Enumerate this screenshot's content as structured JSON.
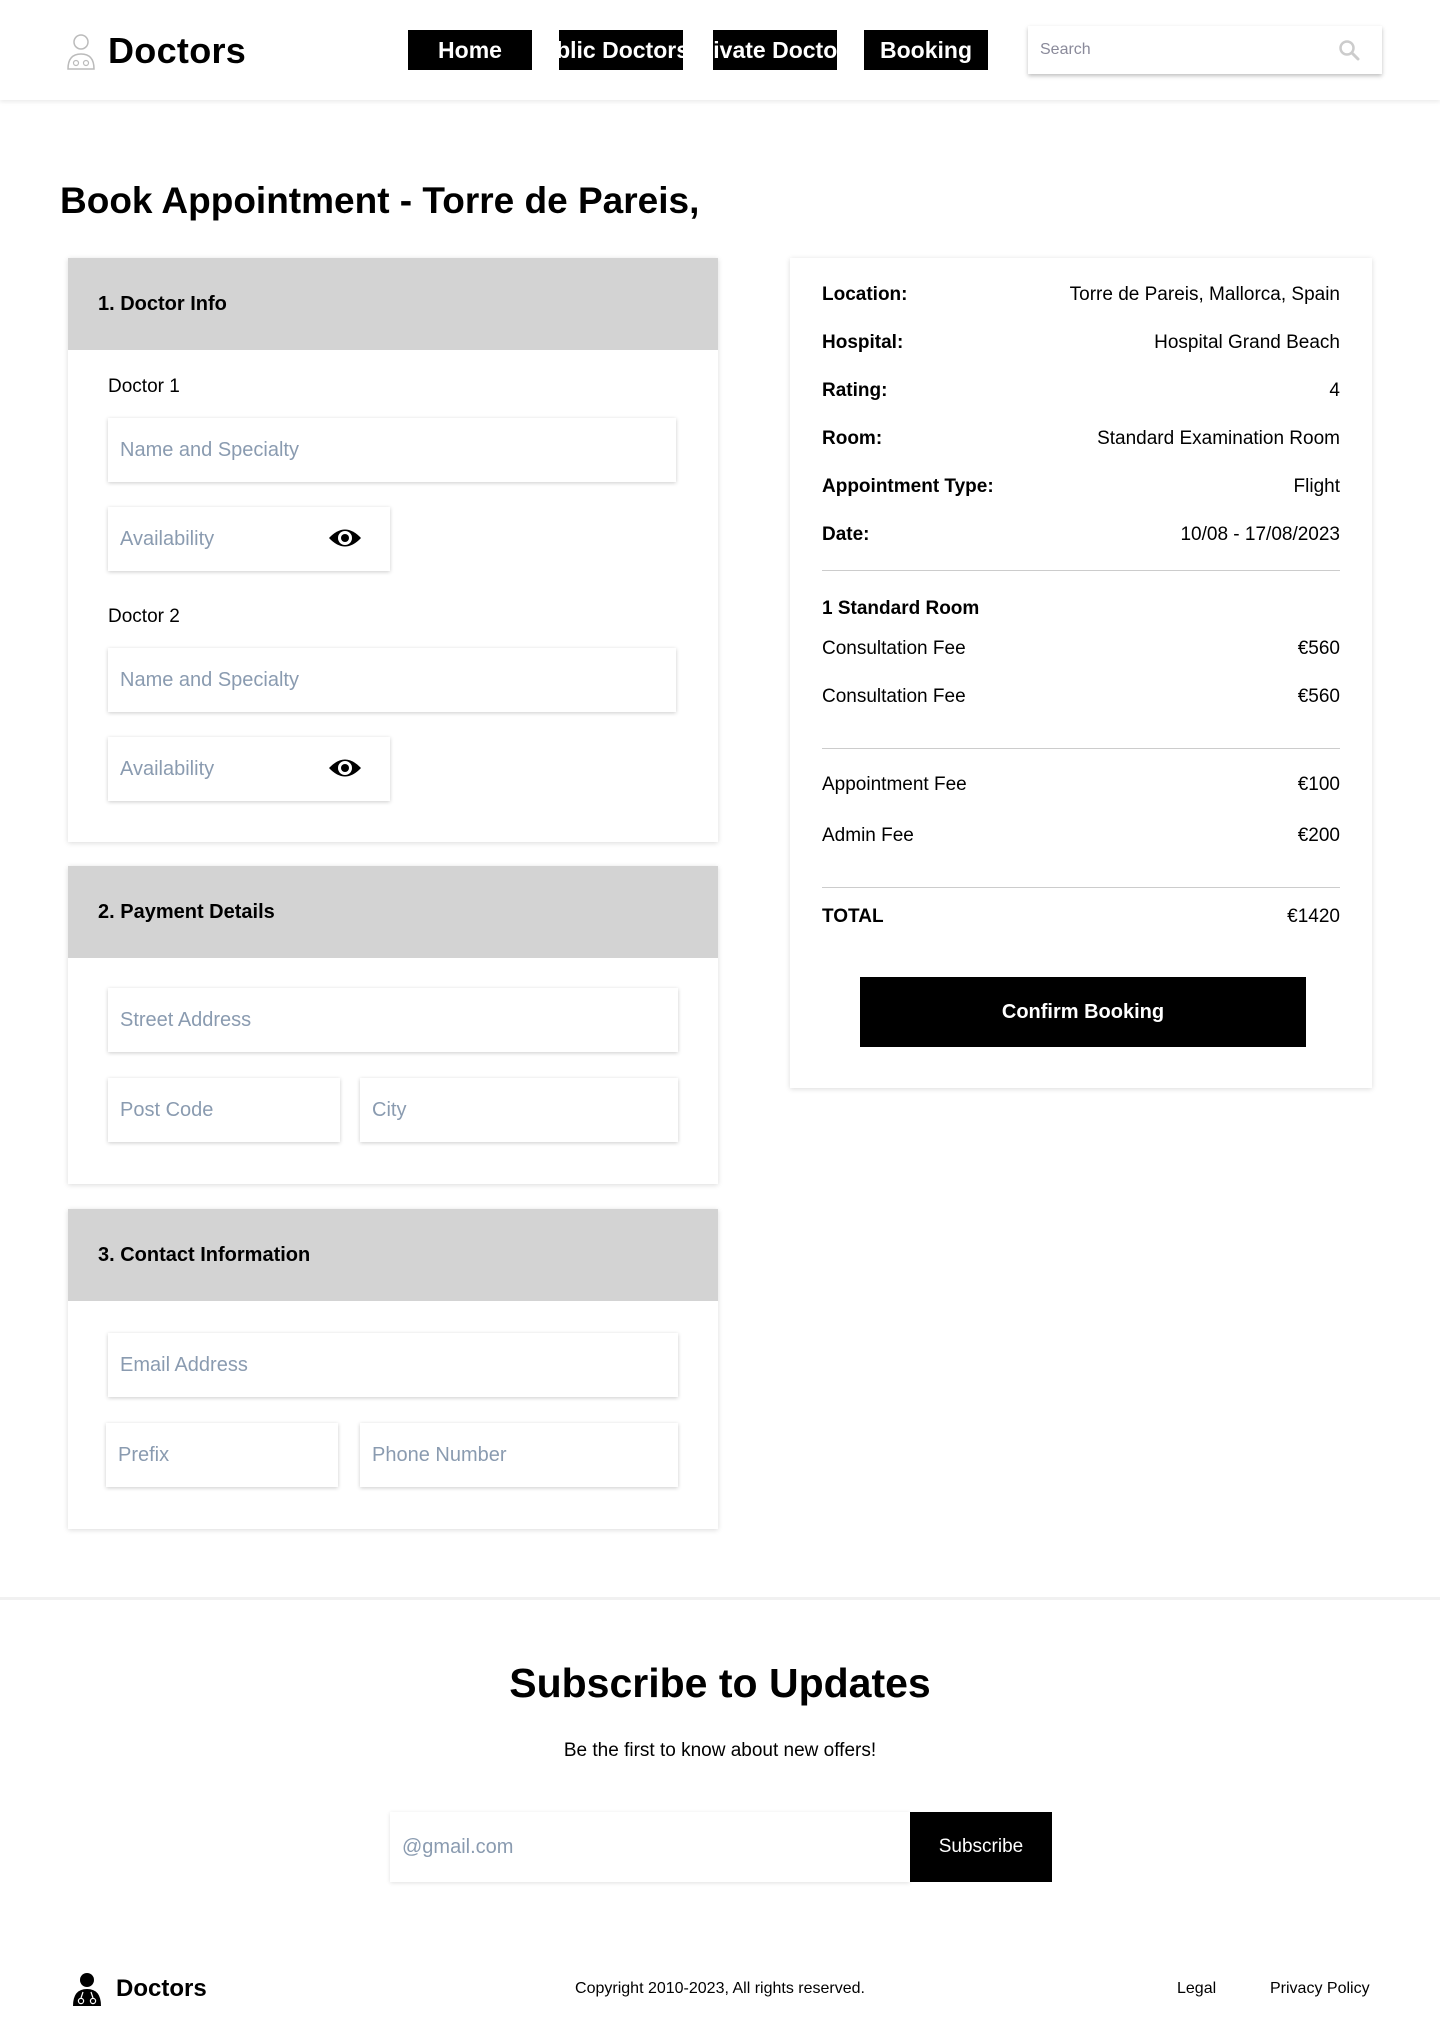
{
  "header": {
    "brand": "Doctors",
    "nav": [
      {
        "label": "Home"
      },
      {
        "label": "Public Doctors"
      },
      {
        "label": "Private Doctors"
      },
      {
        "label": "Booking"
      }
    ],
    "search_placeholder": "Search"
  },
  "page_title": "Book Appointment - Torre de Pareis,",
  "doctor_info": {
    "heading": "1. Doctor Info",
    "doctors": [
      {
        "label": "Doctor 1",
        "name_placeholder": "Name and Specialty",
        "availability_placeholder": "Availability"
      },
      {
        "label": "Doctor 2",
        "name_placeholder": "Name and Specialty",
        "availability_placeholder": "Availability"
      }
    ]
  },
  "payment": {
    "heading": "2. Payment Details",
    "street_placeholder": "Street Address",
    "postcode_placeholder": "Post Code",
    "city_placeholder": "City"
  },
  "contact": {
    "heading": "3. Contact Information",
    "email_placeholder": "Email Address",
    "prefix_placeholder": "Prefix",
    "phone_placeholder": "Phone Number"
  },
  "summary": {
    "details": [
      {
        "key": "Location:",
        "value": "Torre de Pareis, Mallorca, Spain"
      },
      {
        "key": "Hospital:",
        "value": "Hospital Grand Beach"
      },
      {
        "key": "Rating:",
        "value": "4"
      },
      {
        "key": "Room:",
        "value": "Standard Examination Room"
      },
      {
        "key": "Appointment Type:",
        "value": "Flight"
      },
      {
        "key": "Date:",
        "value": "10/08 - 17/08/2023"
      }
    ],
    "room_heading": "1 Standard Room",
    "fees": [
      {
        "key": "Consultation Fee",
        "value": "€560"
      },
      {
        "key": "Consultation Fee",
        "value": "€560"
      }
    ],
    "extra_fees": [
      {
        "key": "Appointment Fee",
        "value": "€100"
      },
      {
        "key": "Admin Fee",
        "value": "€200"
      }
    ],
    "total_label": "TOTAL",
    "total_value": "€1420",
    "confirm_label": "Confirm Booking"
  },
  "subscribe": {
    "title": "Subscribe to Updates",
    "text": "Be the first to know about new offers!",
    "email_placeholder": "@gmail.com",
    "button_label": "Subscribe"
  },
  "footer": {
    "brand": "Doctors",
    "copyright": "Copyright 2010-2023, All rights reserved.",
    "links": [
      {
        "label": "Legal"
      },
      {
        "label": "Privacy Policy"
      }
    ]
  }
}
